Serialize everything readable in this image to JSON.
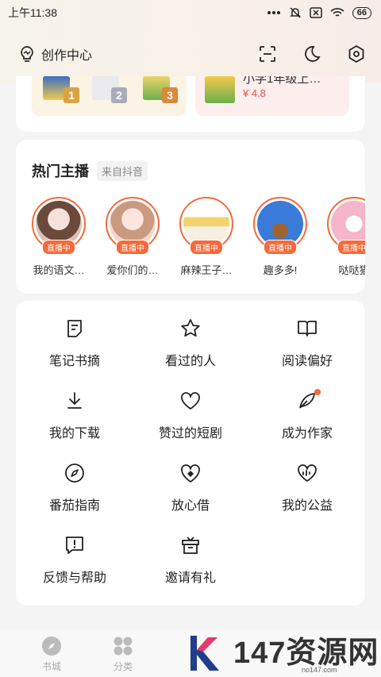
{
  "status_bar": {
    "time": "上午11:38",
    "battery": "66"
  },
  "top_bar": {
    "creator_label": "创作中心"
  },
  "promo": {
    "right_title": "小学1年级上…",
    "right_price": "¥ 4.8",
    "ranks": [
      "1",
      "2",
      "3"
    ]
  },
  "anchors": {
    "title": "热门主播",
    "tag": "来自抖音",
    "live_label": "直播中",
    "items": [
      {
        "name": "我的语文…"
      },
      {
        "name": "爱你们的…"
      },
      {
        "name": "麻辣王子…"
      },
      {
        "name": "趣多多!"
      },
      {
        "name": "哒哒猫"
      }
    ]
  },
  "menu": {
    "items": [
      {
        "label": "笔记书摘",
        "icon": "note-icon"
      },
      {
        "label": "看过的人",
        "icon": "star-icon"
      },
      {
        "label": "阅读偏好",
        "icon": "book-icon"
      },
      {
        "label": "我的下载",
        "icon": "download-icon"
      },
      {
        "label": "赞过的短剧",
        "icon": "heart-icon"
      },
      {
        "label": "成为作家",
        "icon": "pen-icon"
      },
      {
        "label": "番茄指南",
        "icon": "compass-icon"
      },
      {
        "label": "放心借",
        "icon": "shield-heart-icon"
      },
      {
        "label": "我的公益",
        "icon": "charity-icon"
      },
      {
        "label": "反馈与帮助",
        "icon": "feedback-icon"
      },
      {
        "label": "邀请有礼",
        "icon": "gift-icon"
      }
    ]
  },
  "bottom_nav": {
    "items": [
      {
        "label": "书城",
        "icon": "compass-icon"
      },
      {
        "label": "分类",
        "icon": "grid-icon"
      }
    ]
  },
  "watermark": {
    "text": "147资源网",
    "sub": "no147.com"
  },
  "colors": {
    "accent": "#f46a3a",
    "price": "#e8524a"
  }
}
